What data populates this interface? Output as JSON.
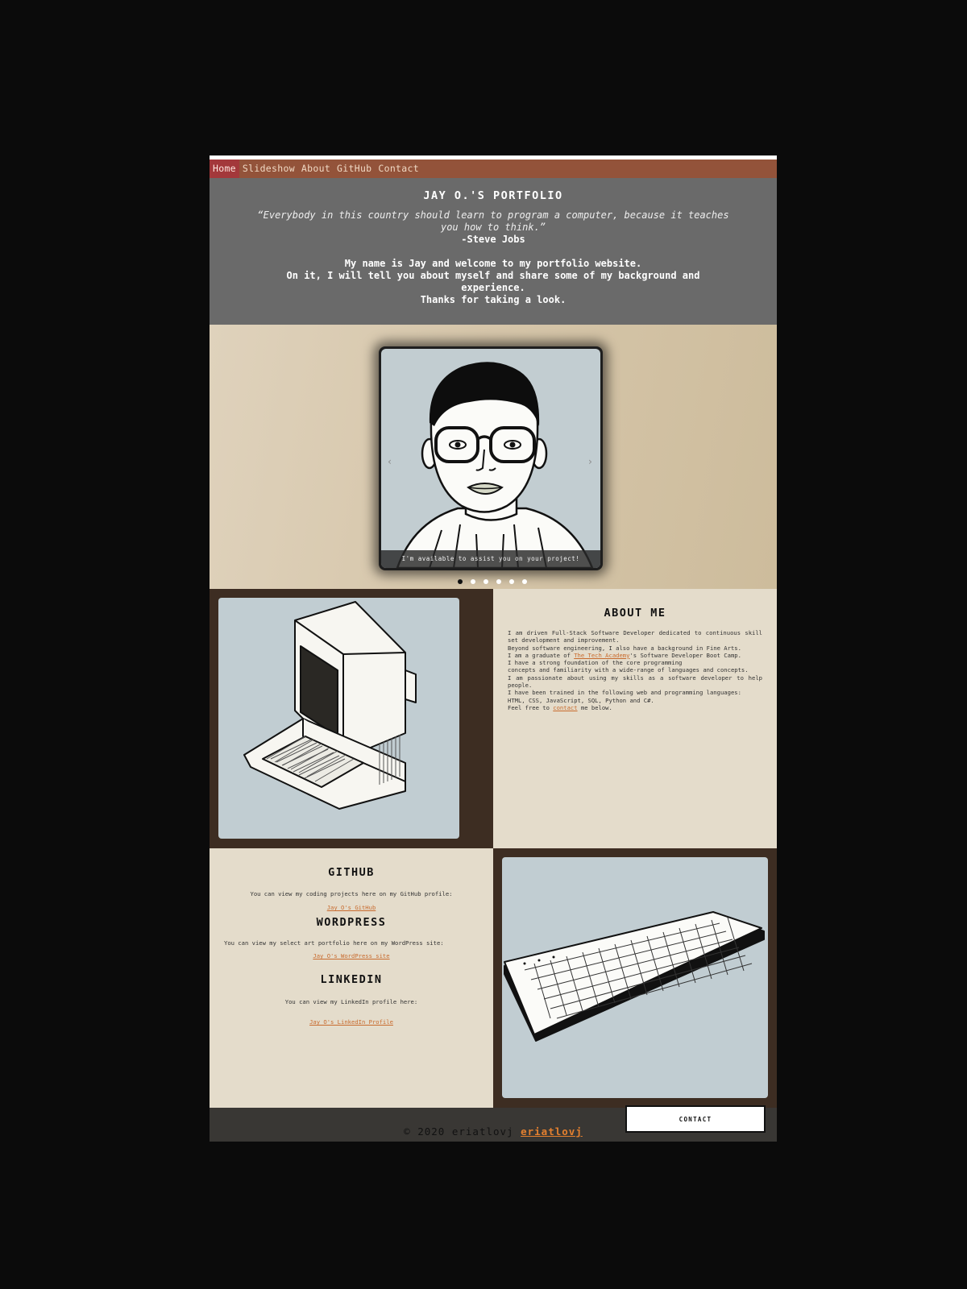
{
  "nav": {
    "items": [
      "Home",
      "Slideshow",
      "About",
      "GitHub",
      "Contact"
    ],
    "active": "Home"
  },
  "hero": {
    "title": "JAY O.'S PORTFOLIO",
    "quote": "“Everybody in this country should learn to program a computer, because it teaches you how to think.”",
    "author": "-Steve Jobs",
    "intro_lines": [
      "My name is Jay and welcome to my portfolio website.",
      "On it, I will tell you about myself and share some of my background and experience.",
      "Thanks for taking a look."
    ]
  },
  "slideshow": {
    "caption": "I'm available to assist you on your project!",
    "prev": "‹",
    "next": "›",
    "dot_count": 6,
    "active_dot": 1
  },
  "about": {
    "title": "ABOUT ME",
    "p1": "I am driven Full-Stack Software Developer dedicated to continuous skill set development and improvement.",
    "p2": "Beyond software engineering, I also have a background in Fine Arts.",
    "p3_before": "I am a graduate of ",
    "p3_link": "The Tech Academy",
    "p3_after": "'s Software Developer Boot Camp.",
    "p4": "I have a strong foundation of the core programming",
    "p5": "concepts and familiarity with a wide-range of languages and concepts.",
    "p6": "I am passionate about using my skills as a software developer to help people.",
    "p7": "I have been trained in the following web and programming languages:",
    "p8": "HTML, CSS, JavaScript, SQL, Python and C#.",
    "p9_before": "Feel free to ",
    "p9_link": "contact",
    "p9_after": " me below."
  },
  "github": {
    "title": "GITHUB",
    "text": "You can view my coding projects here on my GitHub profile:",
    "link": "Jay O's GitHub"
  },
  "wordpress": {
    "title": "WORDPRESS",
    "text": "You can view my select art portfolio here on my WordPress site:",
    "link": "Jay O's WordPress site"
  },
  "linkedin": {
    "title": "LINKEDIN",
    "text": "You can view my LinkedIn profile here:",
    "link": "Jay O's LinkedIn Profile"
  },
  "footer": {
    "copy": "© 2020 eriatlovj",
    "link": "eriatlovj"
  },
  "contact_button": "CONTACT",
  "colors": {
    "nav_bg": "#93533a",
    "nav_active": "#a3383b",
    "hero_bg": "#6a6a6a",
    "light_panel": "#e4dccb",
    "dark_panel": "#3d2d22",
    "link": "#c86b2e",
    "image_bg": "#c1cdd2"
  }
}
